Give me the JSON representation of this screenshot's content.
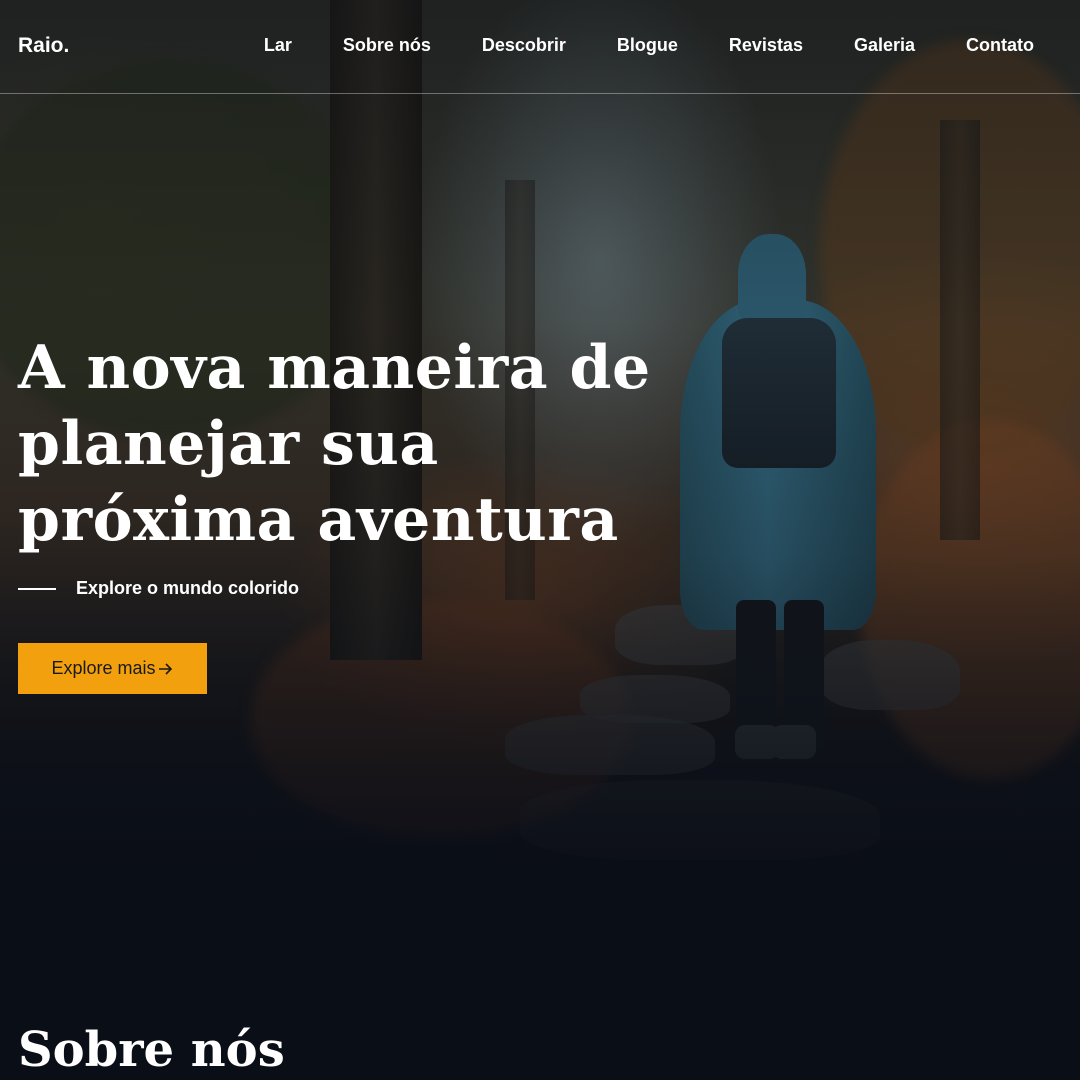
{
  "brand": {
    "logo": "Raio."
  },
  "nav": {
    "items": [
      {
        "label": "Lar"
      },
      {
        "label": "Sobre nós"
      },
      {
        "label": "Descobrir"
      },
      {
        "label": "Blogue"
      },
      {
        "label": "Revistas"
      },
      {
        "label": "Galeria"
      },
      {
        "label": "Contato"
      }
    ]
  },
  "hero": {
    "headline": "A nova maneira de planejar sua próxima aventura",
    "subheading": "Explore o mundo colorido",
    "cta_label": "Explore mais",
    "cta_icon": "arrow-right-icon",
    "cta_color": "#f2a00d"
  },
  "about": {
    "title": "Sobre nós"
  },
  "colors": {
    "background": "#0a0e17",
    "accent": "#f2a00d",
    "text": "#ffffff"
  }
}
